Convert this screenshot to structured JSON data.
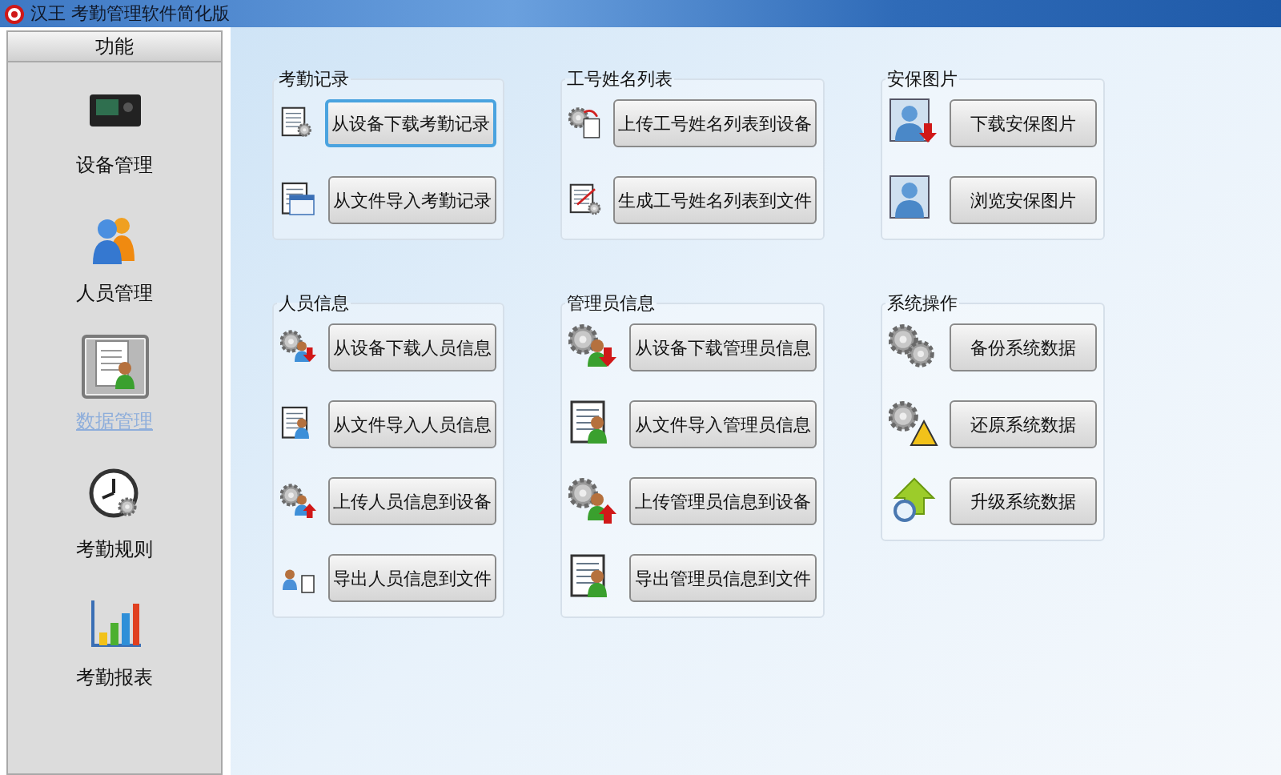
{
  "window": {
    "title": "汉王 考勤管理软件简化版"
  },
  "sidebar": {
    "header": "功能",
    "items": [
      {
        "label": "设备管理",
        "selected": false
      },
      {
        "label": "人员管理",
        "selected": false
      },
      {
        "label": "数据管理",
        "selected": true
      },
      {
        "label": "考勤规则",
        "selected": false
      },
      {
        "label": "考勤报表",
        "selected": false
      }
    ]
  },
  "groups": [
    {
      "title": "考勤记录",
      "buttons": [
        {
          "label": "从设备下载考勤记录",
          "focused": true
        },
        {
          "label": "从文件导入考勤记录",
          "focused": false
        }
      ]
    },
    {
      "title": "工号姓名列表",
      "buttons": [
        {
          "label": "上传工号姓名列表到设备",
          "focused": false
        },
        {
          "label": "生成工号姓名列表到文件",
          "focused": false
        }
      ]
    },
    {
      "title": "安保图片",
      "buttons": [
        {
          "label": "下载安保图片",
          "focused": false
        },
        {
          "label": "浏览安保图片",
          "focused": false
        }
      ]
    },
    {
      "title": "人员信息",
      "buttons": [
        {
          "label": "从设备下载人员信息",
          "focused": false
        },
        {
          "label": "从文件导入人员信息",
          "focused": false
        },
        {
          "label": "上传人员信息到设备",
          "focused": false
        },
        {
          "label": "导出人员信息到文件",
          "focused": false
        }
      ]
    },
    {
      "title": "管理员信息",
      "buttons": [
        {
          "label": "从设备下载管理员信息",
          "focused": false
        },
        {
          "label": "从文件导入管理员信息",
          "focused": false
        },
        {
          "label": "上传管理员信息到设备",
          "focused": false
        },
        {
          "label": "导出管理员信息到文件",
          "focused": false
        }
      ]
    },
    {
      "title": "系统操作",
      "buttons": [
        {
          "label": "备份系统数据",
          "focused": false
        },
        {
          "label": "还原系统数据",
          "focused": false
        },
        {
          "label": "升级系统数据",
          "focused": false
        }
      ]
    }
  ]
}
